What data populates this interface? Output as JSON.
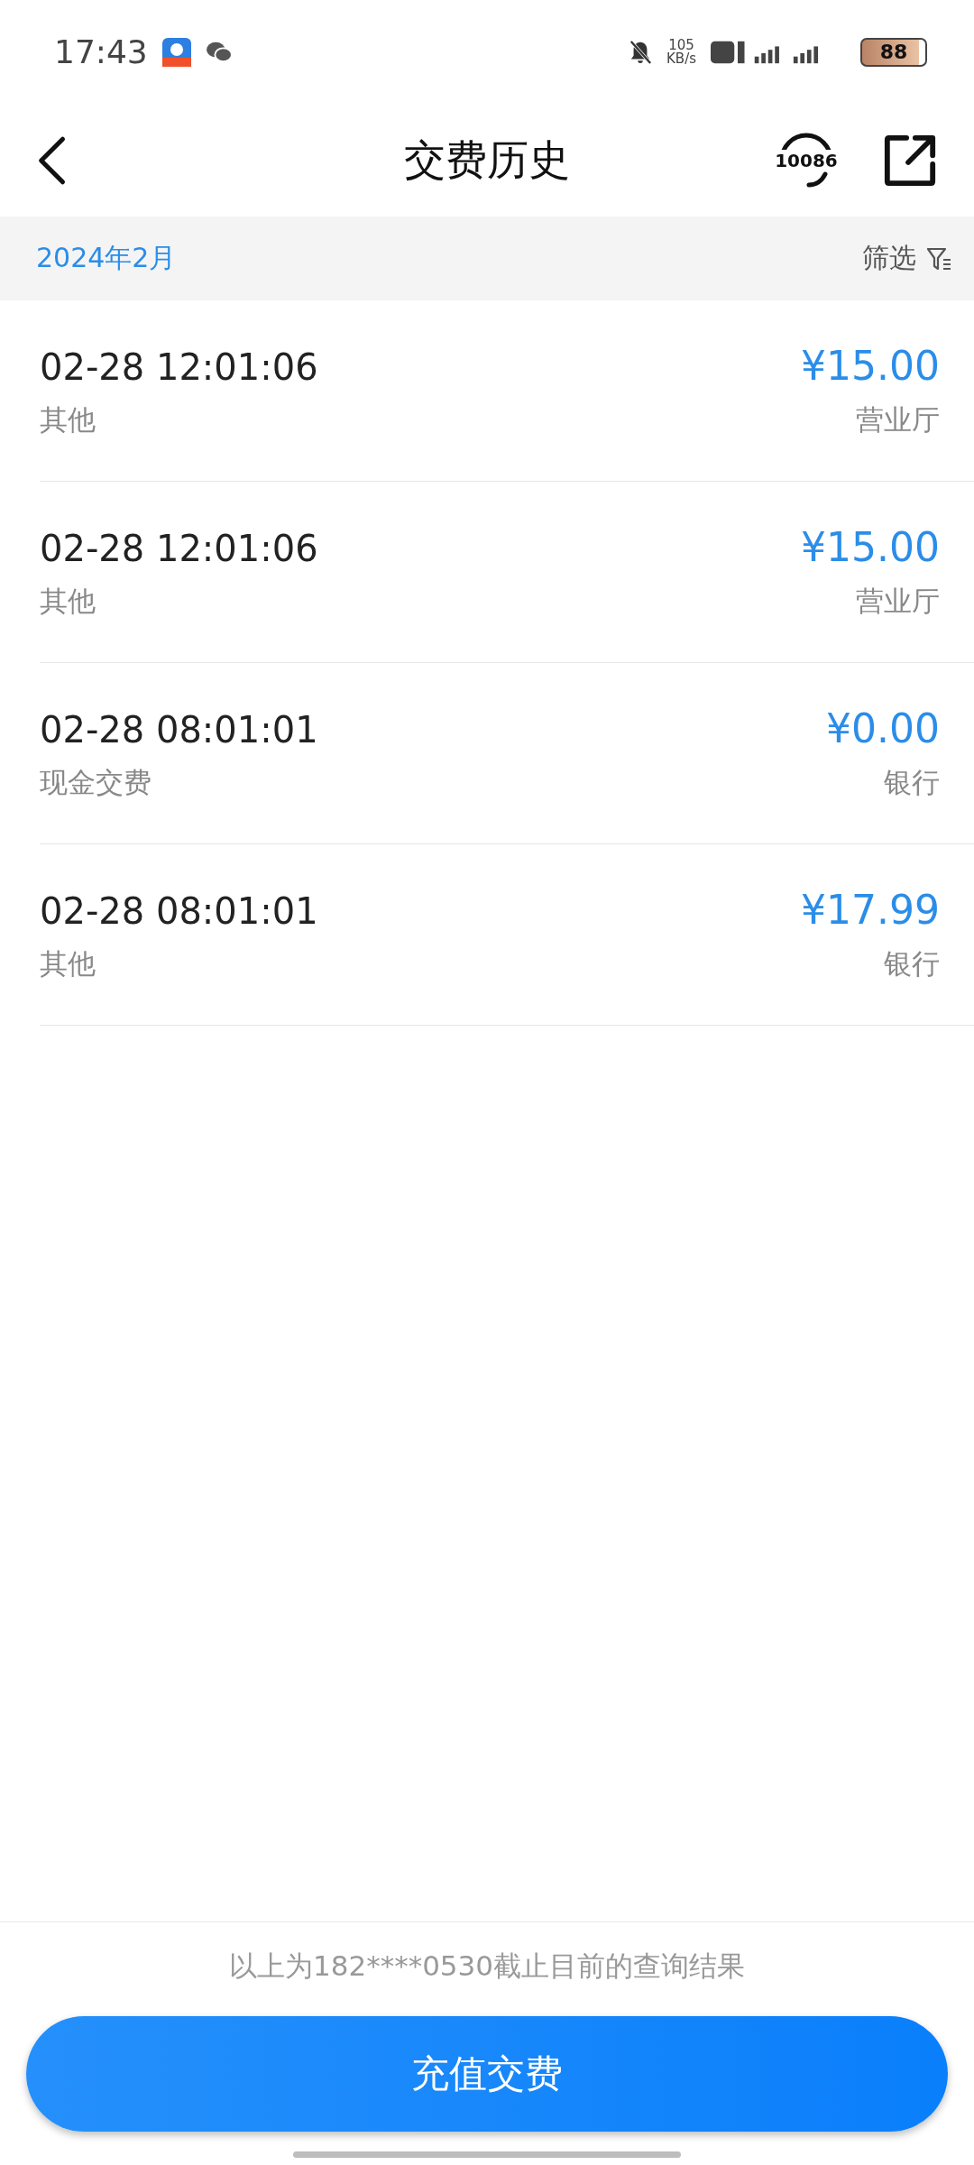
{
  "status_bar": {
    "time": "17:43",
    "speed_value": "105",
    "speed_unit": "KB/s",
    "battery": "88"
  },
  "header": {
    "title": "交费历史",
    "hotline": "10086"
  },
  "month_bar": {
    "month": "2024年2月",
    "filter": "筛选"
  },
  "records": [
    {
      "time": "02-28 12:01:06",
      "amount": "¥15.00",
      "type": "其他",
      "channel": "营业厅"
    },
    {
      "time": "02-28 12:01:06",
      "amount": "¥15.00",
      "type": "其他",
      "channel": "营业厅"
    },
    {
      "time": "02-28 08:01:01",
      "amount": "¥0.00",
      "type": "现金交费",
      "channel": "银行"
    },
    {
      "time": "02-28 08:01:01",
      "amount": "¥17.99",
      "type": "其他",
      "channel": "银行"
    }
  ],
  "footer": {
    "note": "以上为182****0530截止目前的查询结果",
    "button": "充值交费"
  }
}
